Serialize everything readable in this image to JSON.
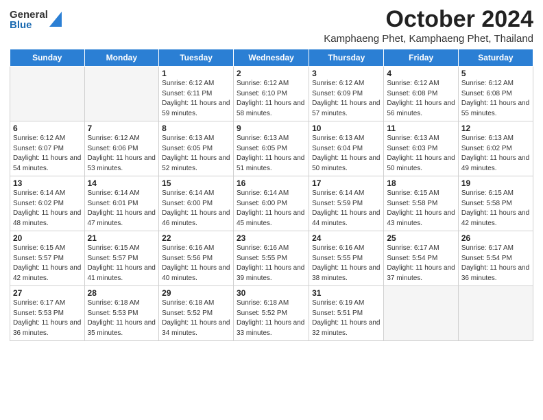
{
  "logo": {
    "general": "General",
    "blue": "Blue"
  },
  "title": "October 2024",
  "subtitle": "Kamphaeng Phet, Kamphaeng Phet, Thailand",
  "days_of_week": [
    "Sunday",
    "Monday",
    "Tuesday",
    "Wednesday",
    "Thursday",
    "Friday",
    "Saturday"
  ],
  "weeks": [
    [
      {
        "day": "",
        "info": ""
      },
      {
        "day": "",
        "info": ""
      },
      {
        "day": "1",
        "info": "Sunrise: 6:12 AM\nSunset: 6:11 PM\nDaylight: 11 hours and 59 minutes."
      },
      {
        "day": "2",
        "info": "Sunrise: 6:12 AM\nSunset: 6:10 PM\nDaylight: 11 hours and 58 minutes."
      },
      {
        "day": "3",
        "info": "Sunrise: 6:12 AM\nSunset: 6:09 PM\nDaylight: 11 hours and 57 minutes."
      },
      {
        "day": "4",
        "info": "Sunrise: 6:12 AM\nSunset: 6:08 PM\nDaylight: 11 hours and 56 minutes."
      },
      {
        "day": "5",
        "info": "Sunrise: 6:12 AM\nSunset: 6:08 PM\nDaylight: 11 hours and 55 minutes."
      }
    ],
    [
      {
        "day": "6",
        "info": "Sunrise: 6:12 AM\nSunset: 6:07 PM\nDaylight: 11 hours and 54 minutes."
      },
      {
        "day": "7",
        "info": "Sunrise: 6:12 AM\nSunset: 6:06 PM\nDaylight: 11 hours and 53 minutes."
      },
      {
        "day": "8",
        "info": "Sunrise: 6:13 AM\nSunset: 6:05 PM\nDaylight: 11 hours and 52 minutes."
      },
      {
        "day": "9",
        "info": "Sunrise: 6:13 AM\nSunset: 6:05 PM\nDaylight: 11 hours and 51 minutes."
      },
      {
        "day": "10",
        "info": "Sunrise: 6:13 AM\nSunset: 6:04 PM\nDaylight: 11 hours and 50 minutes."
      },
      {
        "day": "11",
        "info": "Sunrise: 6:13 AM\nSunset: 6:03 PM\nDaylight: 11 hours and 50 minutes."
      },
      {
        "day": "12",
        "info": "Sunrise: 6:13 AM\nSunset: 6:02 PM\nDaylight: 11 hours and 49 minutes."
      }
    ],
    [
      {
        "day": "13",
        "info": "Sunrise: 6:14 AM\nSunset: 6:02 PM\nDaylight: 11 hours and 48 minutes."
      },
      {
        "day": "14",
        "info": "Sunrise: 6:14 AM\nSunset: 6:01 PM\nDaylight: 11 hours and 47 minutes."
      },
      {
        "day": "15",
        "info": "Sunrise: 6:14 AM\nSunset: 6:00 PM\nDaylight: 11 hours and 46 minutes."
      },
      {
        "day": "16",
        "info": "Sunrise: 6:14 AM\nSunset: 6:00 PM\nDaylight: 11 hours and 45 minutes."
      },
      {
        "day": "17",
        "info": "Sunrise: 6:14 AM\nSunset: 5:59 PM\nDaylight: 11 hours and 44 minutes."
      },
      {
        "day": "18",
        "info": "Sunrise: 6:15 AM\nSunset: 5:58 PM\nDaylight: 11 hours and 43 minutes."
      },
      {
        "day": "19",
        "info": "Sunrise: 6:15 AM\nSunset: 5:58 PM\nDaylight: 11 hours and 42 minutes."
      }
    ],
    [
      {
        "day": "20",
        "info": "Sunrise: 6:15 AM\nSunset: 5:57 PM\nDaylight: 11 hours and 42 minutes."
      },
      {
        "day": "21",
        "info": "Sunrise: 6:15 AM\nSunset: 5:57 PM\nDaylight: 11 hours and 41 minutes."
      },
      {
        "day": "22",
        "info": "Sunrise: 6:16 AM\nSunset: 5:56 PM\nDaylight: 11 hours and 40 minutes."
      },
      {
        "day": "23",
        "info": "Sunrise: 6:16 AM\nSunset: 5:55 PM\nDaylight: 11 hours and 39 minutes."
      },
      {
        "day": "24",
        "info": "Sunrise: 6:16 AM\nSunset: 5:55 PM\nDaylight: 11 hours and 38 minutes."
      },
      {
        "day": "25",
        "info": "Sunrise: 6:17 AM\nSunset: 5:54 PM\nDaylight: 11 hours and 37 minutes."
      },
      {
        "day": "26",
        "info": "Sunrise: 6:17 AM\nSunset: 5:54 PM\nDaylight: 11 hours and 36 minutes."
      }
    ],
    [
      {
        "day": "27",
        "info": "Sunrise: 6:17 AM\nSunset: 5:53 PM\nDaylight: 11 hours and 36 minutes."
      },
      {
        "day": "28",
        "info": "Sunrise: 6:18 AM\nSunset: 5:53 PM\nDaylight: 11 hours and 35 minutes."
      },
      {
        "day": "29",
        "info": "Sunrise: 6:18 AM\nSunset: 5:52 PM\nDaylight: 11 hours and 34 minutes."
      },
      {
        "day": "30",
        "info": "Sunrise: 6:18 AM\nSunset: 5:52 PM\nDaylight: 11 hours and 33 minutes."
      },
      {
        "day": "31",
        "info": "Sunrise: 6:19 AM\nSunset: 5:51 PM\nDaylight: 11 hours and 32 minutes."
      },
      {
        "day": "",
        "info": ""
      },
      {
        "day": "",
        "info": ""
      }
    ]
  ]
}
